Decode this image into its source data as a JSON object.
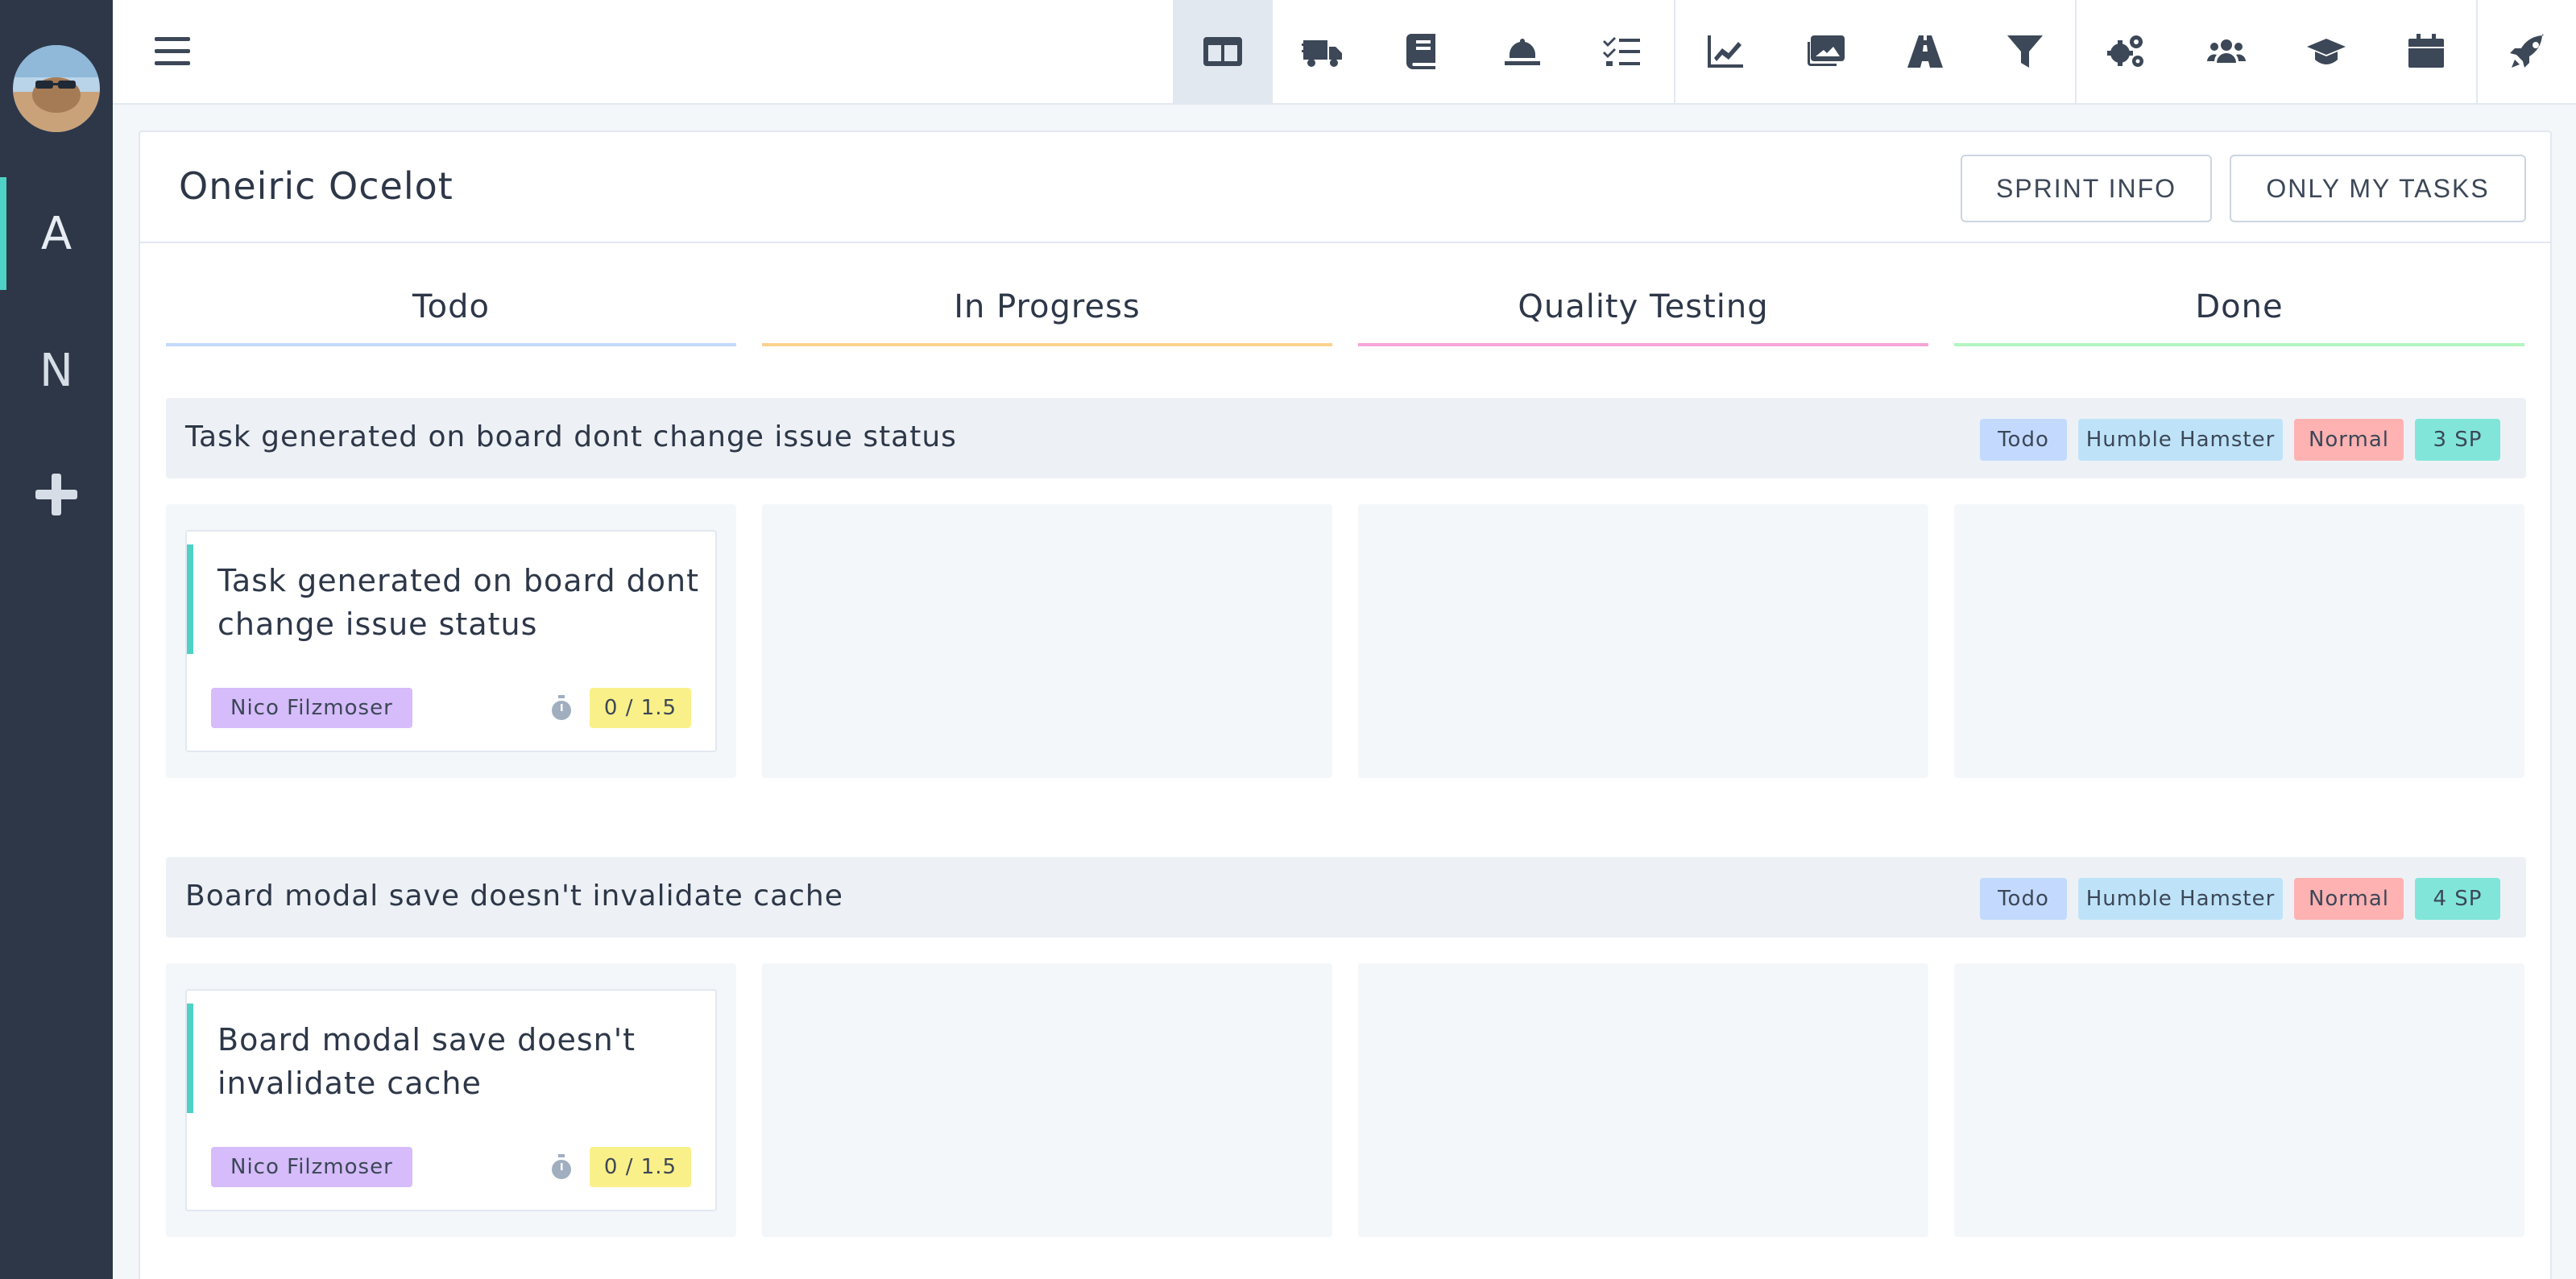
{
  "rail": {
    "items": [
      {
        "label": "A"
      },
      {
        "label": "N"
      }
    ]
  },
  "topbar": {
    "icons": [
      "board-icon",
      "truck-icon",
      "book-icon",
      "bell-icon",
      "tasks-icon",
      "chart-icon",
      "images-icon",
      "road-icon",
      "filter-icon",
      "cogs-icon",
      "users-icon",
      "graduation-cap-icon",
      "calendar-icon",
      "rocket-icon"
    ]
  },
  "board": {
    "title": "Oneiric Ocelot",
    "sprint_info_label": "SPRINT INFO",
    "only_my_tasks_label": "ONLY MY TASKS",
    "columns": [
      {
        "label": "Todo",
        "color": "#c3dafe"
      },
      {
        "label": "In Progress",
        "color": "#fbd38d"
      },
      {
        "label": "Quality Testing",
        "color": "#f6a5d8"
      },
      {
        "label": "Done",
        "color": "#b2f5c0"
      }
    ]
  },
  "issues": [
    {
      "title": "Task generated on board dont change issue status",
      "tags": {
        "status": "Todo",
        "sprint": "Humble Hamster",
        "priority": "Normal",
        "points": "3 SP"
      },
      "card": {
        "title": "Task generated on board dont change issue status",
        "assignee": "Nico Filzmoser",
        "estimate": "0 / 1.5"
      }
    },
    {
      "title": "Board modal save doesn't invalidate cache",
      "tags": {
        "status": "Todo",
        "sprint": "Humble Hamster",
        "priority": "Normal",
        "points": "4 SP"
      },
      "card": {
        "title": "Board modal save doesn't invalidate cache",
        "assignee": "Nico Filzmoser",
        "estimate": "0 / 1.5"
      }
    }
  ],
  "colors": {
    "rail_bg": "#2d3748",
    "accent": "#4fd1c5",
    "tag_status": "#c3dafe",
    "tag_sprint": "#bee3f8",
    "tag_priority": "#feb2b2",
    "tag_points": "#81e6d9",
    "assignee_bg": "#d6bcfa",
    "estimate_bg": "#faf089"
  }
}
